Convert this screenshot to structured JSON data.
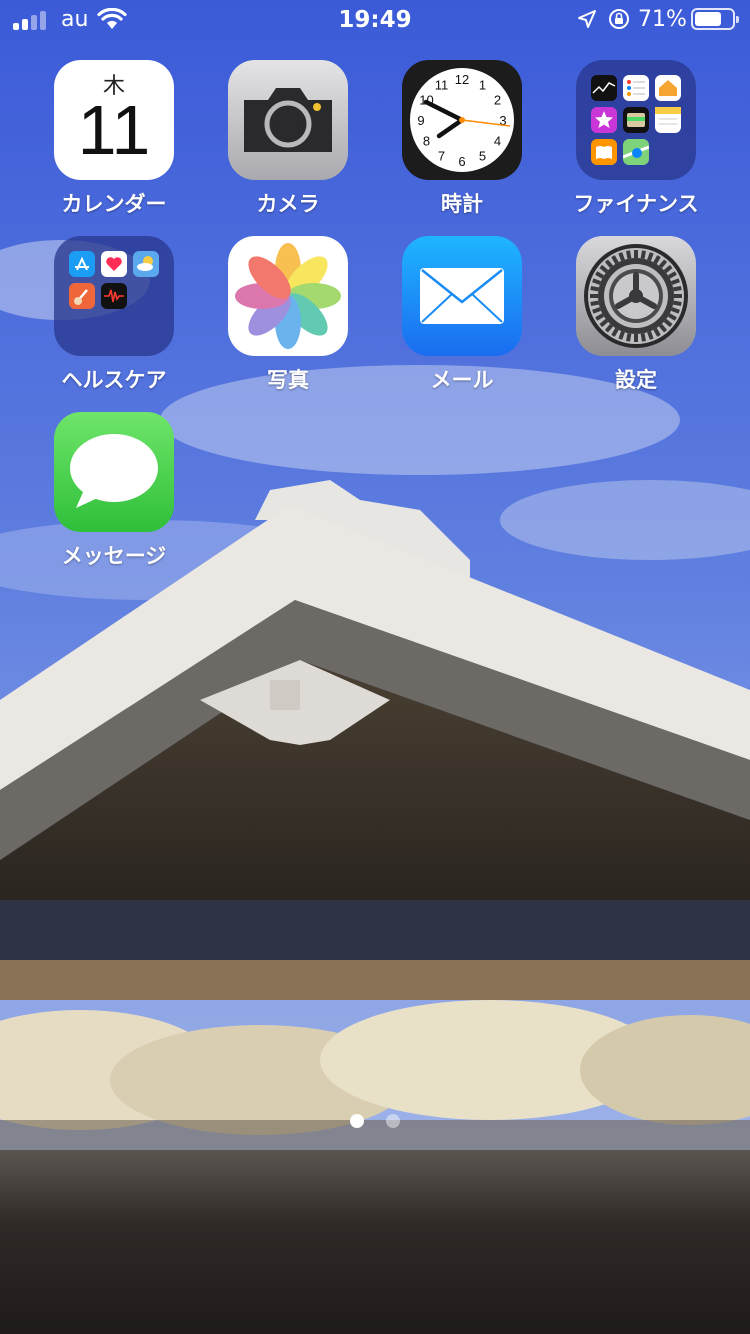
{
  "status_bar": {
    "carrier": "au",
    "time": "19:49",
    "battery_percent_text": "71%",
    "battery_level": 0.71,
    "signal_bars_active": 2,
    "signal_bars_total": 4
  },
  "apps": [
    {
      "name": "calendar",
      "label": "カレンダー",
      "weekday": "木",
      "day": "11"
    },
    {
      "name": "camera",
      "label": "カメラ"
    },
    {
      "name": "clock",
      "label": "時計",
      "clock_numbers": [
        "12",
        "1",
        "2",
        "3",
        "4",
        "5",
        "6",
        "7",
        "8",
        "9",
        "10",
        "11"
      ]
    },
    {
      "name": "finance-folder",
      "label": "ファイナンス"
    },
    {
      "name": "healthcare-folder",
      "label": "ヘルスケア"
    },
    {
      "name": "photos",
      "label": "写真"
    },
    {
      "name": "mail",
      "label": "メール"
    },
    {
      "name": "settings",
      "label": "設定"
    },
    {
      "name": "messages",
      "label": "メッセージ"
    }
  ],
  "page_dots": {
    "count": 2,
    "active_index": 0
  },
  "colors": {
    "sky_top": "#3f5ed6",
    "sky_bottom": "#8aa4e4",
    "dock_top": "#5c5651",
    "dock_bottom": "#1f1b19",
    "folder_bg": "#28378c",
    "clock_second_hand": "#ff8c00"
  }
}
